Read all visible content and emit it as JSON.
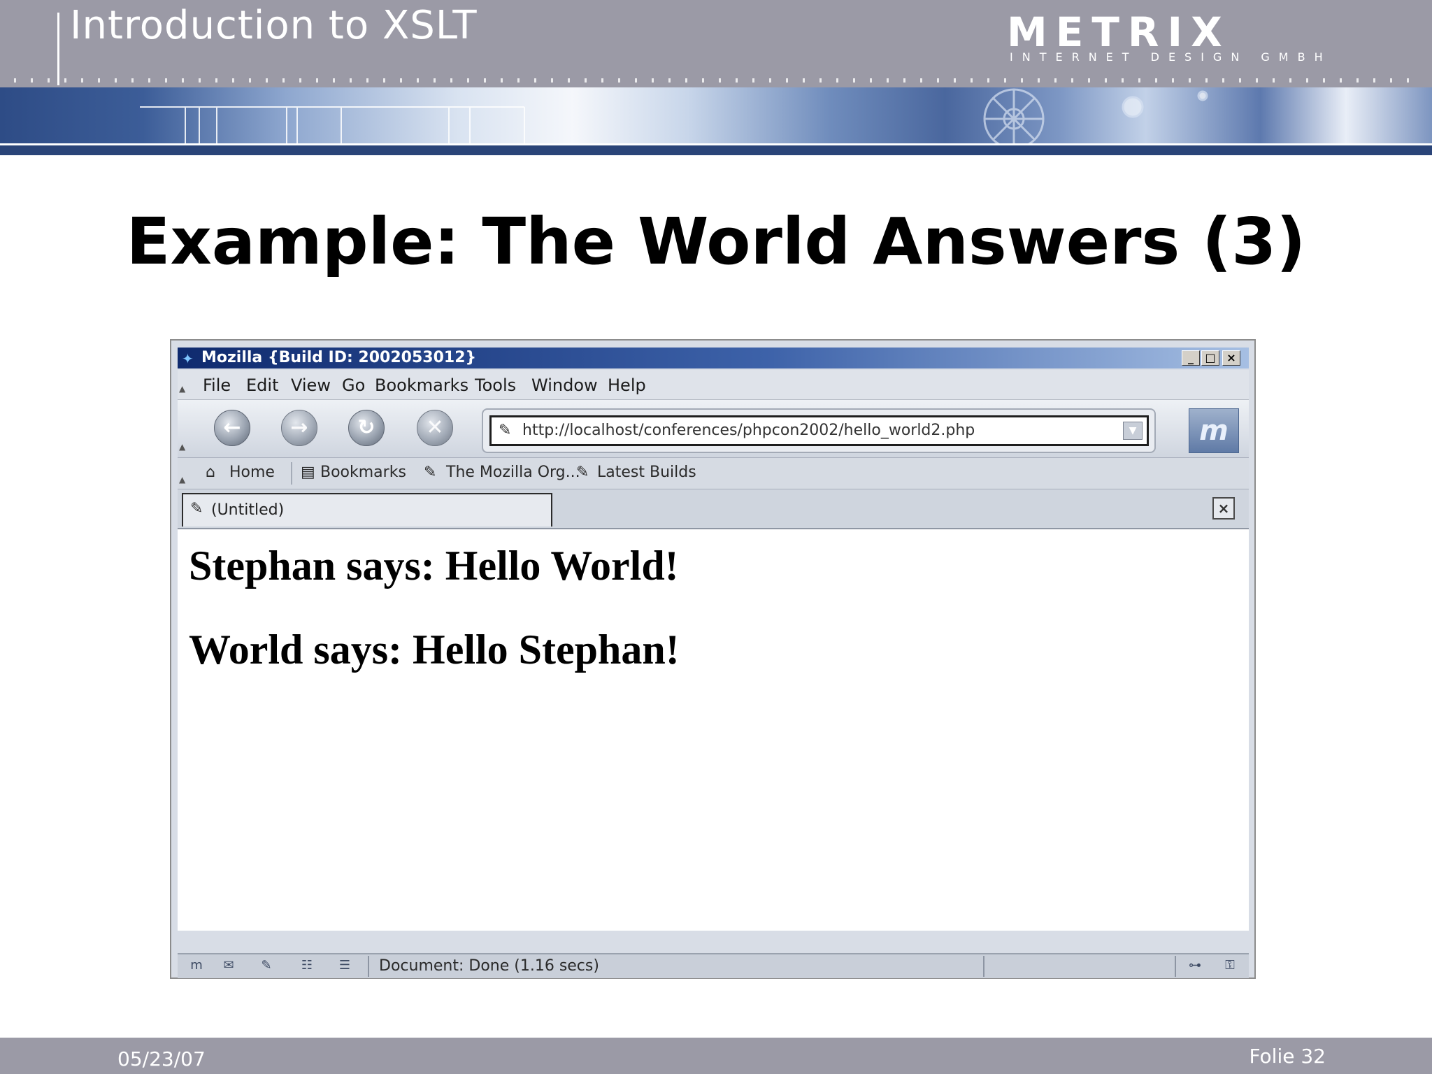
{
  "header": {
    "title": "Introduction to XSLT",
    "logo_text": "METRIX",
    "logo_subtext": "INTERNET DESIGN GMBH"
  },
  "slide": {
    "title": "Example: The World Answers (3)"
  },
  "browser": {
    "window_title": "Mozilla {Build ID: 2002053012}",
    "menu": [
      "File",
      "Edit",
      "View",
      "Go",
      "Bookmarks",
      "Tools",
      "Window",
      "Help"
    ],
    "url": "http://localhost/conferences/phpcon2002/hello_world2.php",
    "personal_toolbar": [
      "Home",
      "Bookmarks",
      "The Mozilla Org...",
      "Latest Builds"
    ],
    "tab_label": "(Untitled)",
    "content_lines": [
      "Stephan says: Hello World!",
      "World says: Hello Stephan!"
    ],
    "status_text": "Document: Done (1.16 secs)",
    "icons": {
      "back": "back-arrow-icon",
      "forward": "forward-arrow-icon",
      "reload": "reload-icon",
      "stop": "stop-icon"
    }
  },
  "footer": {
    "date": "05/23/07",
    "page": "Folie 32"
  },
  "colors": {
    "header_bg": "#9b9aa6",
    "banner_blue": "#2e4c86",
    "titlebar_blue": "#0f2a6e"
  }
}
